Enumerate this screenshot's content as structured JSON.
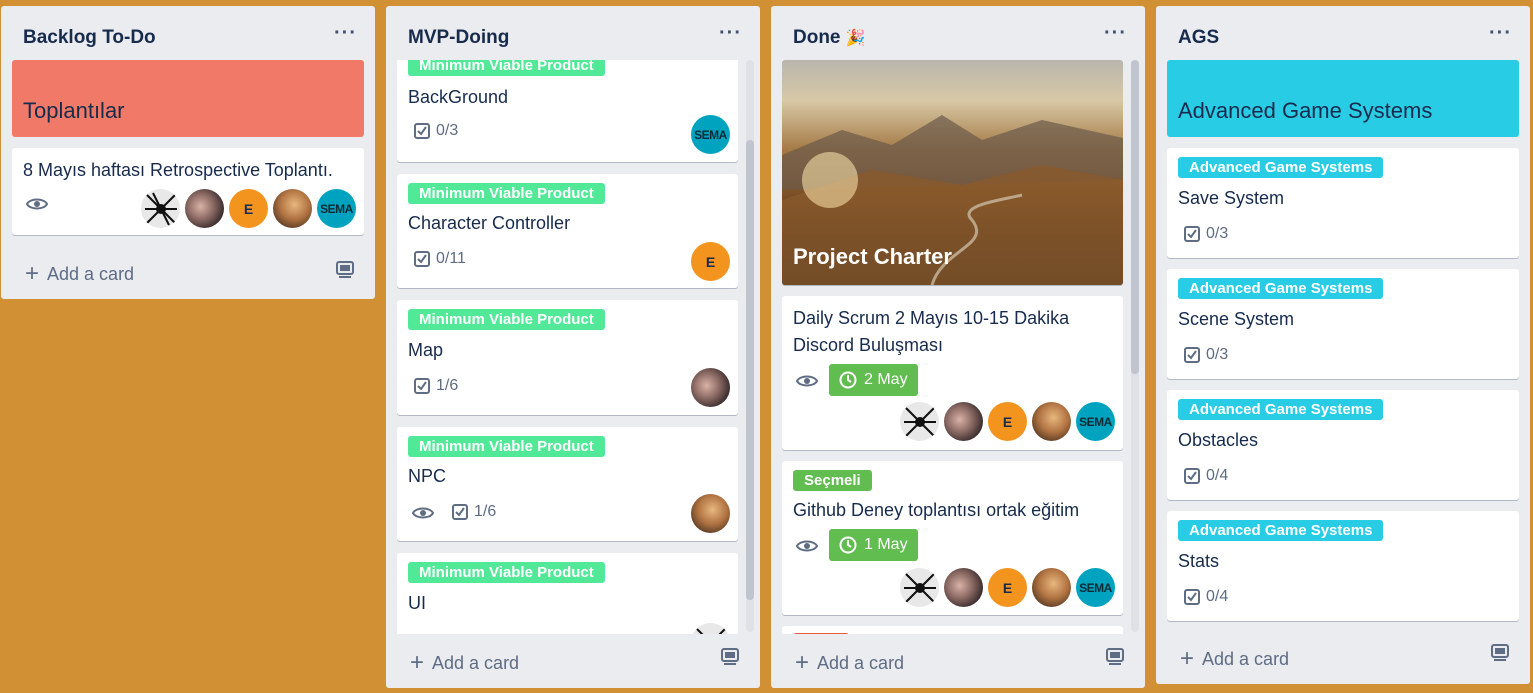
{
  "colors": {
    "board_bg": "#d29034",
    "list_bg": "#ebecf0",
    "label_green": "#51e898",
    "label_darkgreen": "#61bd4f",
    "label_cyan": "#29cce5",
    "cover_red": "#f07a67",
    "cover_cyan": "#29cce5",
    "date_green": "#61bd4f"
  },
  "lists": [
    {
      "title": "Backlog To-Do",
      "menu": "···",
      "cover_card": {
        "title": "Toplantılar"
      },
      "cards": [
        {
          "title": "8 Mayıs haftası Retrospective Toplantı.",
          "members": [
            "spider",
            "photo1",
            "E",
            "photo2",
            "SEMA"
          ]
        }
      ],
      "add_card": "Add a card"
    },
    {
      "title": "MVP-Doing",
      "menu": "···",
      "cards": [
        {
          "label": "Minimum Viable Product",
          "title": "BackGround",
          "checklist": "0/3",
          "member": "SEMA"
        },
        {
          "label": "Minimum Viable Product",
          "title": "Character Controller",
          "checklist": "0/11",
          "member": "E"
        },
        {
          "label": "Minimum Viable Product",
          "title": "Map",
          "checklist": "1/6",
          "member": "photo1"
        },
        {
          "label": "Minimum Viable Product",
          "title": "NPC",
          "checklist": "1/6",
          "member": "photo2"
        },
        {
          "label": "Minimum Viable Product",
          "title": "UI",
          "member": "spider"
        }
      ],
      "add_card": "Add a card"
    },
    {
      "title": "Done",
      "title_emoji": "🎉",
      "menu": "···",
      "cards": [
        {
          "cover_title": "Project Charter"
        },
        {
          "title_line1": "Daily Scrum 2 Mayıs 10-15 Dakika",
          "title_line2": "Discord Buluşması",
          "date": "2 May",
          "members": [
            "spider",
            "photo1",
            "E",
            "photo2",
            "SEMA"
          ]
        },
        {
          "label": "Seçmeli",
          "title": "Github Deney toplantısı ortak eğitim",
          "date": "1 May",
          "members": [
            "spider",
            "photo1",
            "E",
            "photo2",
            "SEMA"
          ]
        }
      ],
      "add_card": "Add a card"
    },
    {
      "title": "AGS",
      "menu": "···",
      "cover_card": {
        "title": "Advanced Game Systems"
      },
      "cards": [
        {
          "label": "Advanced Game Systems",
          "title": "Save System",
          "checklist": "0/3"
        },
        {
          "label": "Advanced Game Systems",
          "title": "Scene System",
          "checklist": "0/3"
        },
        {
          "label": "Advanced Game Systems",
          "title": "Obstacles",
          "checklist": "0/4"
        },
        {
          "label": "Advanced Game Systems",
          "title": "Stats",
          "checklist": "0/4"
        }
      ],
      "add_card": "Add a card"
    }
  ],
  "avatars": {
    "E": "E",
    "SEMA": "SEMA"
  }
}
